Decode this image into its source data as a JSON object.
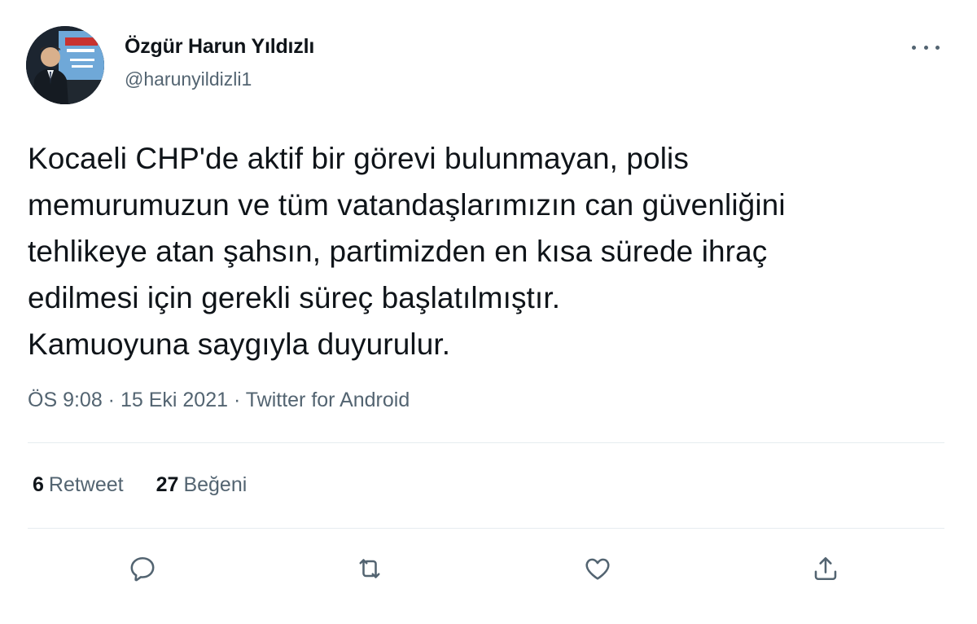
{
  "user": {
    "display_name": "Özgür Harun Yıldızlı",
    "handle": "@harunyildizli1",
    "avatar_icon": "profile-photo"
  },
  "tweet": {
    "lines": [
      "Kocaeli CHP'de aktif bir görevi bulunmayan, polis",
      "memurumuzun ve tüm vatandaşlarımızın can güvenliğini",
      "tehlikeye atan şahsın, partimizden en kısa sürede ihraç",
      "edilmesi için gerekli süreç başlatılmıştır.",
      "Kamuoyuna saygıyla duyurulur."
    ]
  },
  "meta": {
    "time": "ÖS 9:08",
    "separator1": " · ",
    "date": "15 Eki 2021",
    "separator2": " · ",
    "source": "Twitter for Android"
  },
  "stats": {
    "retweets_count": "6",
    "retweets_label": "Retweet",
    "likes_count": "27",
    "likes_label": "Beğeni"
  },
  "actions": {
    "reply_icon": "reply-icon",
    "retweet_icon": "retweet-icon",
    "like_icon": "heart-icon",
    "share_icon": "share-icon"
  },
  "colors": {
    "text": "#0f1419",
    "secondary": "#536471",
    "divider": "#e6ecf0"
  }
}
